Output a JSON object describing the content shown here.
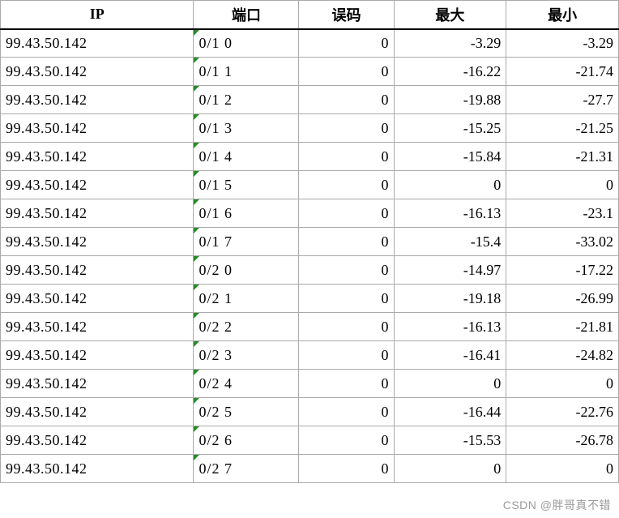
{
  "headers": {
    "ip": "IP",
    "port": "端口",
    "err": "误码",
    "max": "最大",
    "min": "最小"
  },
  "rows": [
    {
      "ip": "99.43.50.142",
      "port": "0/1 0",
      "err": "0",
      "max": "-3.29",
      "min": "-3.29"
    },
    {
      "ip": "99.43.50.142",
      "port": "0/1 1",
      "err": "0",
      "max": "-16.22",
      "min": "-21.74"
    },
    {
      "ip": "99.43.50.142",
      "port": "0/1 2",
      "err": "0",
      "max": "-19.88",
      "min": "-27.7"
    },
    {
      "ip": "99.43.50.142",
      "port": "0/1 3",
      "err": "0",
      "max": "-15.25",
      "min": "-21.25"
    },
    {
      "ip": "99.43.50.142",
      "port": "0/1 4",
      "err": "0",
      "max": "-15.84",
      "min": "-21.31"
    },
    {
      "ip": "99.43.50.142",
      "port": "0/1 5",
      "err": "0",
      "max": "0",
      "min": "0"
    },
    {
      "ip": "99.43.50.142",
      "port": "0/1 6",
      "err": "0",
      "max": "-16.13",
      "min": "-23.1"
    },
    {
      "ip": "99.43.50.142",
      "port": "0/1 7",
      "err": "0",
      "max": "-15.4",
      "min": "-33.02"
    },
    {
      "ip": "99.43.50.142",
      "port": "0/2 0",
      "err": "0",
      "max": "-14.97",
      "min": "-17.22"
    },
    {
      "ip": "99.43.50.142",
      "port": "0/2 1",
      "err": "0",
      "max": "-19.18",
      "min": "-26.99"
    },
    {
      "ip": "99.43.50.142",
      "port": "0/2 2",
      "err": "0",
      "max": "-16.13",
      "min": "-21.81"
    },
    {
      "ip": "99.43.50.142",
      "port": "0/2 3",
      "err": "0",
      "max": "-16.41",
      "min": "-24.82"
    },
    {
      "ip": "99.43.50.142",
      "port": "0/2 4",
      "err": "0",
      "max": "0",
      "min": "0"
    },
    {
      "ip": "99.43.50.142",
      "port": "0/2 5",
      "err": "0",
      "max": "-16.44",
      "min": "-22.76"
    },
    {
      "ip": "99.43.50.142",
      "port": "0/2 6",
      "err": "0",
      "max": "-15.53",
      "min": "-26.78"
    },
    {
      "ip": "99.43.50.142",
      "port": "0/2 7",
      "err": "0",
      "max": "0",
      "min": "0"
    }
  ],
  "watermark": "CSDN @胖哥真不错"
}
